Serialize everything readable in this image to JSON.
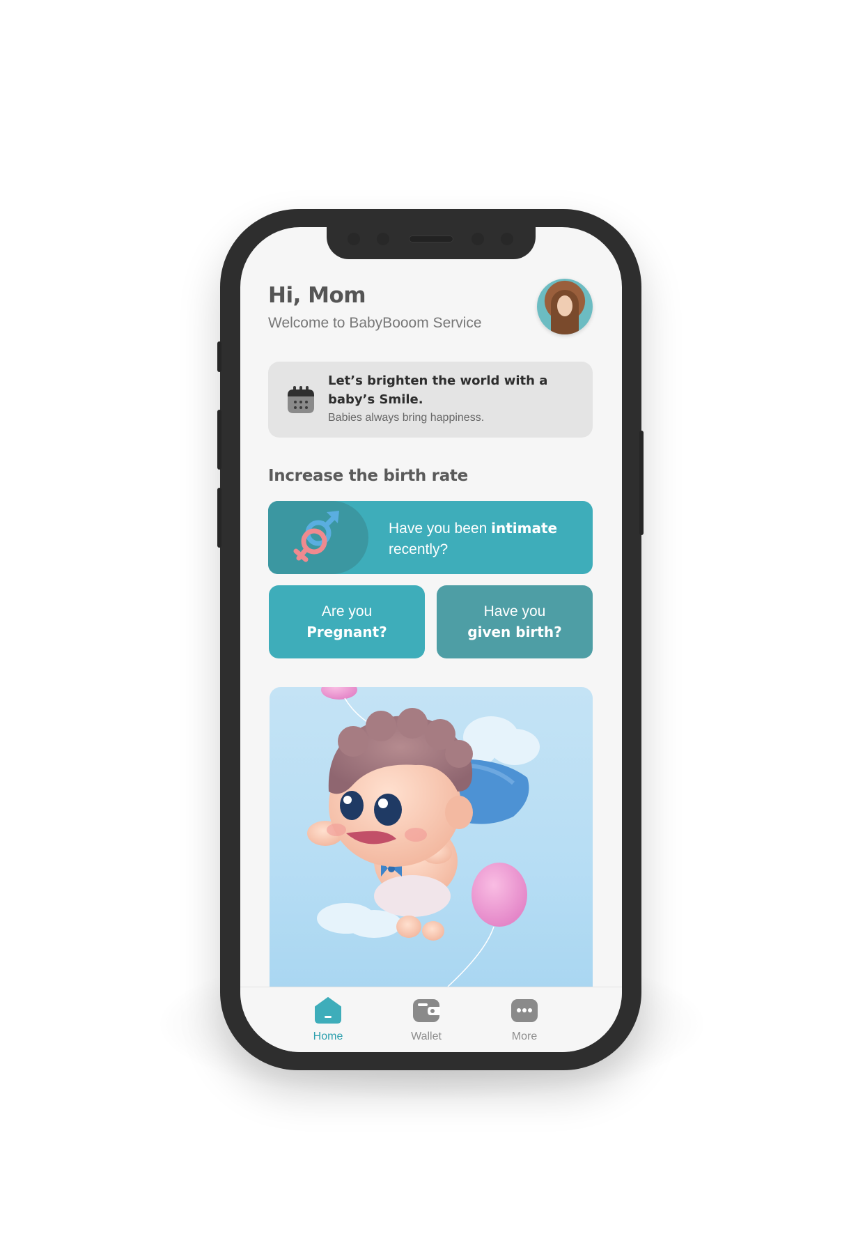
{
  "header": {
    "title": "Hi, Mom",
    "subtitle": "Welcome to BabyBooom Service"
  },
  "banner": {
    "icon": "calendar-icon",
    "title": "Let’s brighten the world with a baby’s Smile.",
    "subtitle": "Babies always bring happiness."
  },
  "section": {
    "title": "Increase the birth rate"
  },
  "cards": {
    "intimate": {
      "icon": "gender-symbol-icon",
      "text_before": "Have you been ",
      "text_bold": "intimate",
      "text_after": "recently?"
    },
    "pregnant": {
      "line1": "Are you",
      "line2": "Pregnant?"
    },
    "birth": {
      "line1": "Have you",
      "line2": "given birth?"
    }
  },
  "tabbar": {
    "items": [
      {
        "label": "Home",
        "icon": "home-icon",
        "active": true
      },
      {
        "label": "Wallet",
        "icon": "wallet-icon",
        "active": false
      },
      {
        "label": "More",
        "icon": "more-icon",
        "active": false
      }
    ]
  },
  "colors": {
    "primary": "#3eadba",
    "primary_dark": "#4e9ea5",
    "background": "#f6f6f6",
    "tab_active": "#2c9fad",
    "tab_inactive": "#8d8d8d"
  }
}
